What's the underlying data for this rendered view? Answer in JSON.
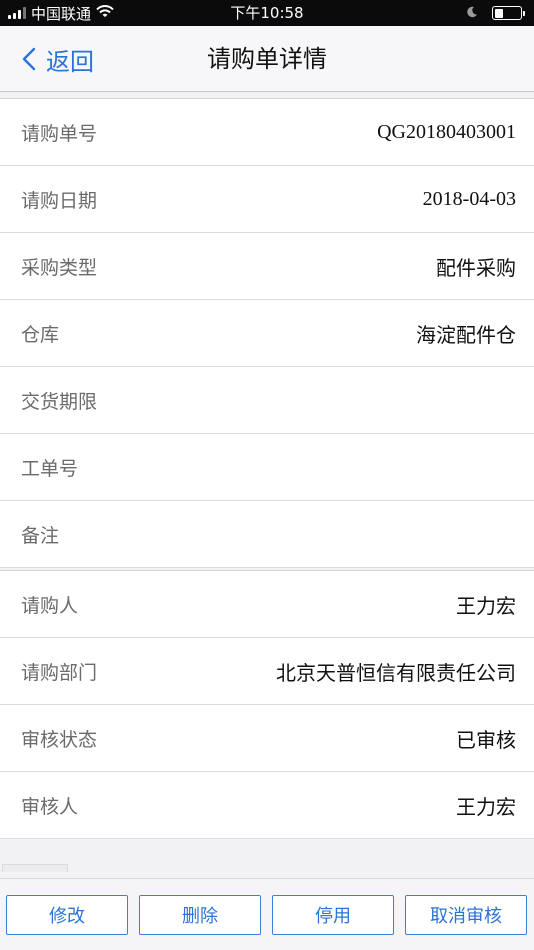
{
  "status_bar": {
    "carrier": "中国联通",
    "time": "下午10:58",
    "battery_level": 0.35,
    "icons": [
      "signal-icon",
      "wifi-icon",
      "moon-icon",
      "battery-icon"
    ]
  },
  "nav": {
    "back_label": "返回",
    "title": "请购单详情",
    "accent": "#2b73d6"
  },
  "details": {
    "group1": [
      {
        "label": "请购单号",
        "value": "QG20180403001"
      },
      {
        "label": "请购日期",
        "value": "2018-04-03"
      },
      {
        "label": "采购类型",
        "value": "配件采购"
      },
      {
        "label": "仓库",
        "value": "海淀配件仓"
      },
      {
        "label": "交货期限",
        "value": ""
      },
      {
        "label": "工单号",
        "value": ""
      },
      {
        "label": "备注",
        "value": ""
      }
    ],
    "group2": [
      {
        "label": "请购人",
        "value": "王力宏"
      },
      {
        "label": "请购部门",
        "value": "北京天普恒信有限责任公司"
      },
      {
        "label": "审核状态",
        "value": "已审核"
      },
      {
        "label": "审核人",
        "value": "王力宏"
      }
    ]
  },
  "toolbar": {
    "edit_label": "修改",
    "delete_label": "删除",
    "disable_label": "停用",
    "cancel_review_label": "取消审核"
  }
}
